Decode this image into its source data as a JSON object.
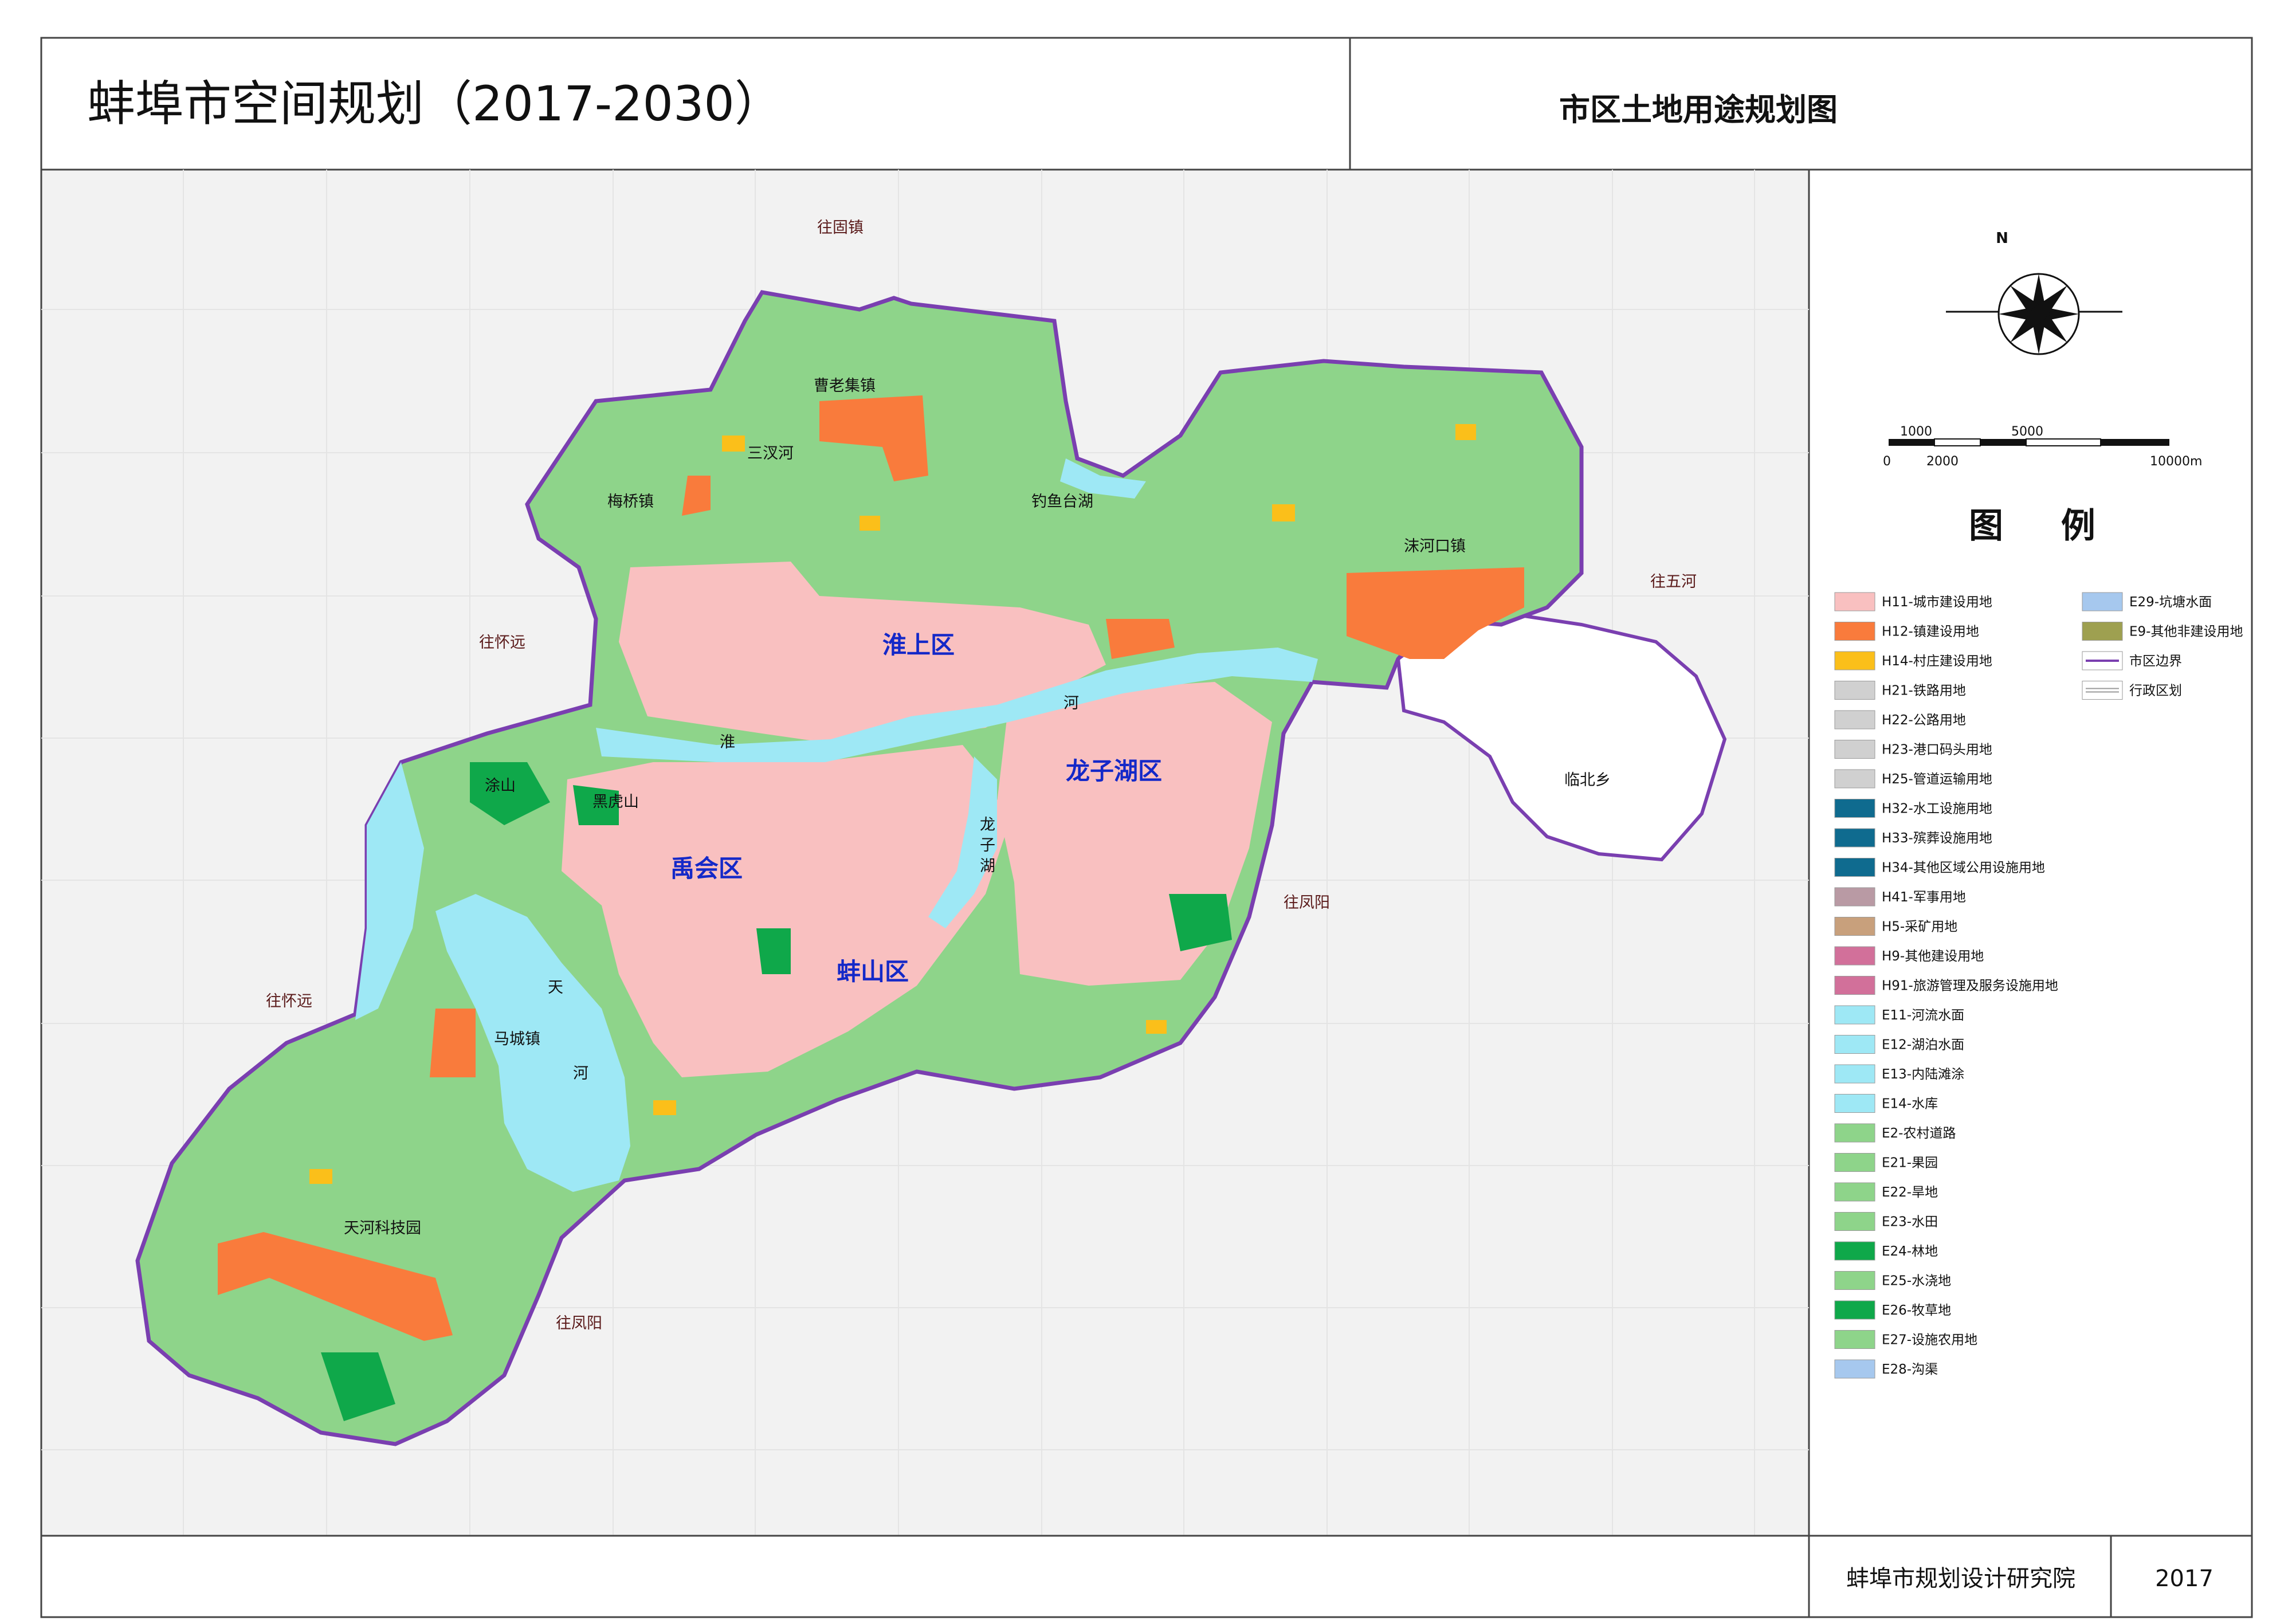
{
  "header": {
    "plan_title": "蚌埠市空间规划（2017-2030）",
    "map_title": "市区土地用途规划图"
  },
  "footer": {
    "institute": "蚌埠市规划设计研究院",
    "year": "2017"
  },
  "map": {
    "districts": [
      "淮上区",
      "龙子湖区",
      "禹会区",
      "蚌山区"
    ],
    "towns": [
      "曹老集镇",
      "梅桥镇",
      "钓鱼台湖",
      "沫河口镇",
      "涂山",
      "黑虎山",
      "马城镇",
      "天河科技园",
      "临北乡",
      "三汊河"
    ],
    "directions": [
      "往固镇",
      "往五河",
      "往怀远",
      "往凤阳",
      "往怀远",
      "往凤阳"
    ],
    "water_labels": [
      "淮",
      "河",
      "龙",
      "子",
      "湖",
      "天",
      "河"
    ]
  },
  "north_arrow": {
    "label": "N"
  },
  "scale_bar": {
    "labels_top": [
      "1000",
      "5000"
    ],
    "labels_bottom": [
      "0",
      "2000",
      "10000m"
    ]
  },
  "legend": {
    "title": "图  例",
    "left_column": [
      {
        "label": "H11-城市建设用地",
        "color": "#f9c0c0"
      },
      {
        "label": "H12-镇建设用地",
        "color": "#f97b3c"
      },
      {
        "label": "H14-村庄建设用地",
        "color": "#fbbf1a"
      },
      {
        "label": "H21-铁路用地",
        "color": "#d0d0d0"
      },
      {
        "label": "H22-公路用地",
        "color": "#d0d0d0"
      },
      {
        "label": "H23-港口码头用地",
        "color": "#d0d0d0"
      },
      {
        "label": "H25-管道运输用地",
        "color": "#d0d0d0"
      },
      {
        "label": "H32-水工设施用地",
        "color": "#0f6b8f"
      },
      {
        "label": "H33-殡葬设施用地",
        "color": "#0f6b8f"
      },
      {
        "label": "H34-其他区域公用设施用地",
        "color": "#0f6b8f"
      },
      {
        "label": "H41-军事用地",
        "color": "#b99aa4"
      },
      {
        "label": "H5-采矿用地",
        "color": "#c8a07c"
      },
      {
        "label": "H9-其他建设用地",
        "color": "#d2709a"
      },
      {
        "label": "H91-旅游管理及服务设施用地",
        "color": "#d2709a"
      },
      {
        "label": "E11-河流水面",
        "color": "#9ee8f5"
      },
      {
        "label": "E12-湖泊水面",
        "color": "#9ee8f5"
      },
      {
        "label": "E13-内陆滩涂",
        "color": "#9ee8f5"
      },
      {
        "label": "E14-水库",
        "color": "#9ee8f5"
      },
      {
        "label": "E2-农村道路",
        "color": "#8ed48a"
      },
      {
        "label": "E21-果园",
        "color": "#8ed48a"
      },
      {
        "label": "E22-旱地",
        "color": "#8ed48a"
      },
      {
        "label": "E23-水田",
        "color": "#8ed48a"
      },
      {
        "label": "E24-林地",
        "color": "#0fa84a"
      },
      {
        "label": "E25-水浇地",
        "color": "#8ed48a"
      },
      {
        "label": "E26-牧草地",
        "color": "#0fa84a"
      },
      {
        "label": "E27-设施农用地",
        "color": "#8ed48a"
      },
      {
        "label": "E28-沟渠",
        "color": "#a6c8ee"
      }
    ],
    "right_column": [
      {
        "label": "E29-坑塘水面",
        "color": "#a6c8ee",
        "kind": "swatch"
      },
      {
        "label": "E9-其他非建设用地",
        "color": "#9ea050",
        "kind": "swatch"
      },
      {
        "label": "市区边界",
        "color": "#7a3fb0",
        "kind": "line"
      },
      {
        "label": "行政区划",
        "color": "#9a9a9a",
        "kind": "double-line"
      }
    ]
  },
  "colors": {
    "urban": "#f9c0c0",
    "town": "#f97b3c",
    "village": "#fbbf1a",
    "farmland": "#8ed48a",
    "forest": "#0fa84a",
    "water": "#9ee8f5",
    "boundary": "#7a3fb0",
    "map_background": "#f2f2f2",
    "district_label": "#1428c8"
  }
}
